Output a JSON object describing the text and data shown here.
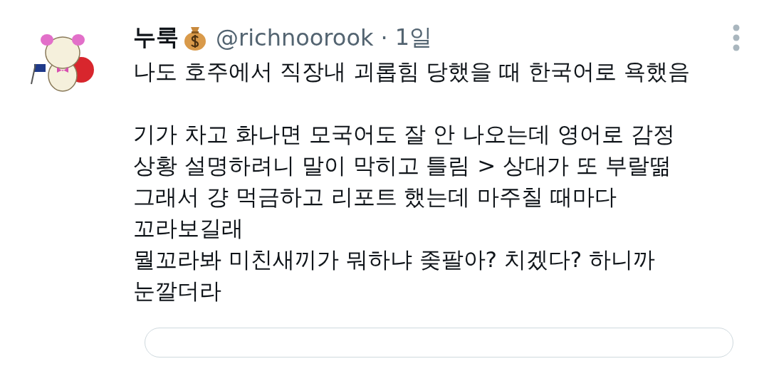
{
  "tweet": {
    "author": {
      "name": "누룩",
      "handle": "@richnoorook",
      "separator": "·",
      "time": "1일"
    },
    "paragraphs": [
      "나도 호주에서 직장내 괴롭힘 당했을 때 한국어로 욕했음",
      "기가 차고 화나면 모국어도 잘 안 나오는데 영어로 감정\n상황 설명하려니 말이 막히고 틀림 > 상대가 또 부랄떪\n그래서 걍 먹금하고 리포트 했는데 마주칠 때마다\n꼬라보길래\n뭘꼬라봐 미친새끼가 뭐하냐 좆팔아? 치겠다? 하니까\n눈깔더라"
    ]
  }
}
